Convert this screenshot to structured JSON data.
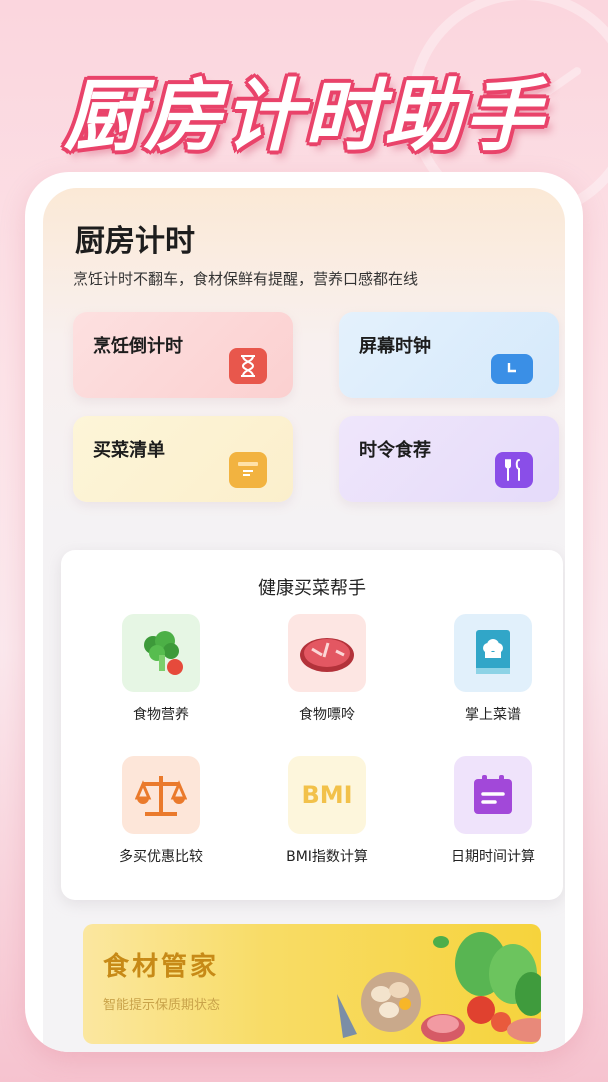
{
  "headline": "厨房计时助手",
  "app": {
    "title": "厨房计时",
    "subtitle": "烹饪计时不翻车，食材保鲜有提醒，营养口感都在线"
  },
  "tiles": [
    {
      "label": "烹饪倒计时",
      "icon": "hourglass-icon",
      "color": "#e8574c"
    },
    {
      "label": "屏幕时钟",
      "icon": "clock-icon",
      "color": "#3a8fe6"
    },
    {
      "label": "买菜清单",
      "icon": "list-box-icon",
      "color": "#f2b340"
    },
    {
      "label": "时令食荐",
      "icon": "fork-knife-icon",
      "color": "#8a4ee8"
    }
  ],
  "helper": {
    "title": "健康买菜帮手",
    "items": [
      {
        "label": "食物营养",
        "icon": "broccoli-icon"
      },
      {
        "label": "食物嘌呤",
        "icon": "meat-icon"
      },
      {
        "label": "掌上菜谱",
        "icon": "recipe-book-icon"
      },
      {
        "label": "多买优惠比较",
        "icon": "scale-icon"
      },
      {
        "label": "BMI指数计算",
        "icon": "bmi-icon",
        "badge": "BMI"
      },
      {
        "label": "日期时间计算",
        "icon": "calendar-icon"
      }
    ]
  },
  "banner": {
    "title": "食材管家",
    "subtitle": "智能提示保质期状态"
  }
}
